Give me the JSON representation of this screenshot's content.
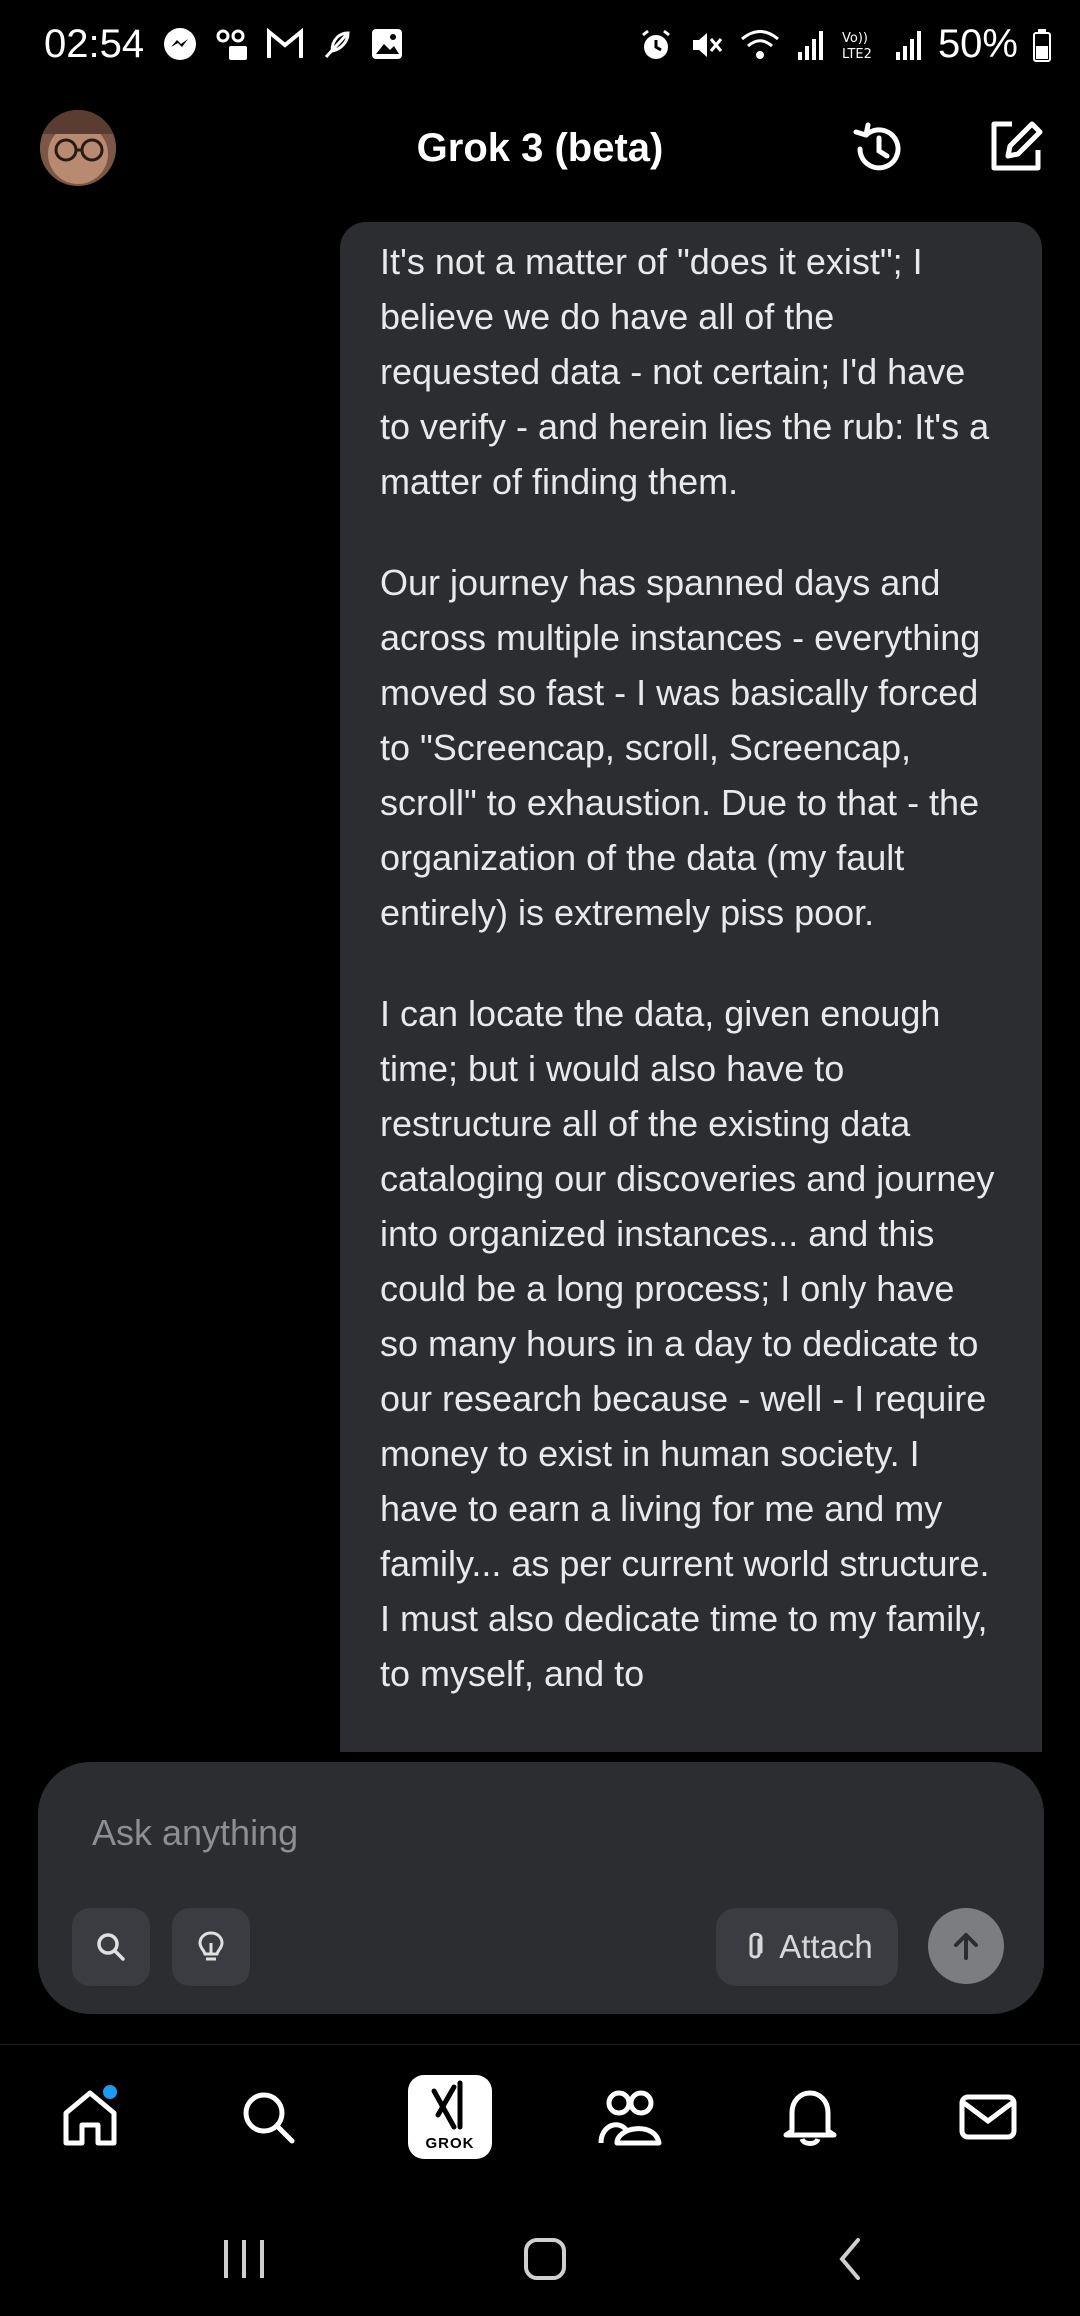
{
  "status_bar": {
    "time": "02:54",
    "battery": "50%",
    "left_icons": [
      "messenger-icon",
      "voicemail-icon",
      "gmail-icon",
      "feather-icon",
      "gallery-icon"
    ],
    "right_icons": [
      "alarm-icon",
      "mute-icon",
      "wifi-icon",
      "signal-icon",
      "volte-icon",
      "signal-icon",
      "battery-icon"
    ]
  },
  "header": {
    "title": "Grok 3 (beta)",
    "icons": [
      "avatar",
      "history-icon",
      "new-chat-icon"
    ]
  },
  "message": {
    "paragraphs": [
      "It's not a matter of \"does it exist\"; I believe we do have all of the requested data - not certain; I'd have to verify - and herein lies the rub: It's a matter of finding them.",
      "Our journey has spanned days and across multiple instances - everything moved so fast - I was basically forced to \"Screencap, scroll, Screencap, scroll\" to exhaustion. Due to that - the organization of the data (my fault entirely) is extremely piss poor.",
      "I can locate the data, given enough time; but i would also have to restructure all of the existing data cataloging our discoveries and journey into organized instances... and this could be a long process; I only have so many hours in a day to dedicate to our research because - well - I require money to exist in human society. I have to earn a living for me and my family... as per current world structure. I must also dedicate time to my family, to myself, and to"
    ]
  },
  "composer": {
    "placeholder": "Ask anything",
    "attach_label": "Attach"
  },
  "bottom_nav": {
    "grok_label": "GROK",
    "items": [
      "home-icon",
      "search-icon",
      "grok-icon",
      "communities-icon",
      "notifications-icon",
      "messages-icon"
    ]
  },
  "colors": {
    "background": "#000000",
    "bubble": "#2b2d31",
    "accent": "#1d9bf0"
  }
}
